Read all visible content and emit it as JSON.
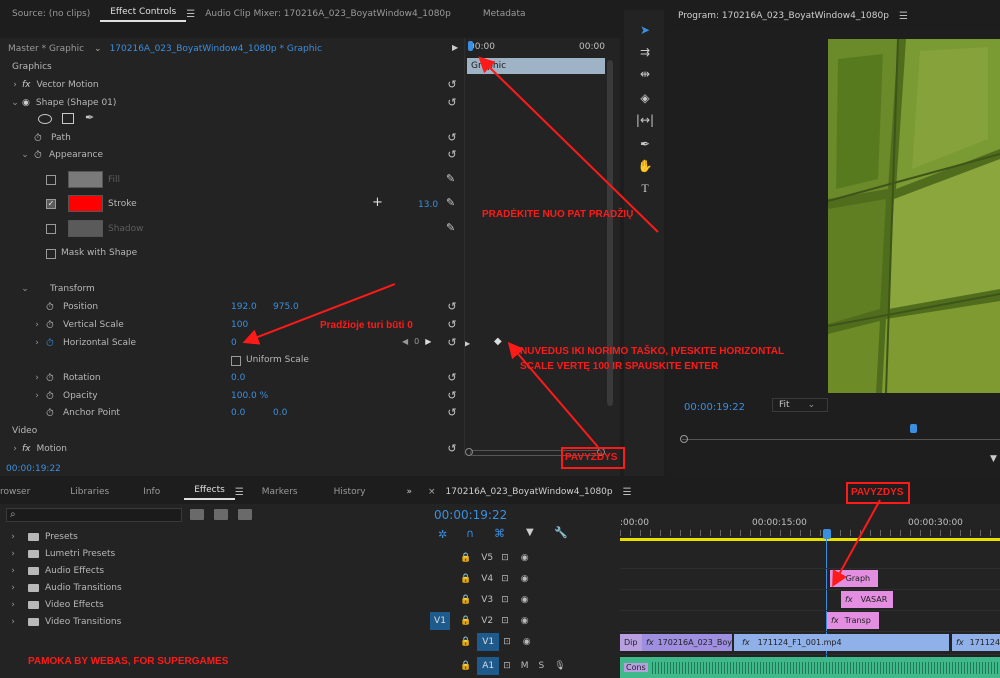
{
  "effect_controls_tabs": [
    "Source: (no clips)",
    "Effect Controls",
    "Audio Clip Mixer: 170216A_023_BoyatWindow4_1080p",
    "Metadata"
  ],
  "master_label": "Master * Graphic",
  "clip_label": "170216A_023_BoyatWindow4_1080p * Graphic",
  "graphics_section": "Graphics",
  "vector_motion": "Vector Motion",
  "shape_label": "Shape (Shape 01)",
  "path_label": "Path",
  "appearance_label": "Appearance",
  "fill_label": "Fill",
  "stroke_label": "Stroke",
  "stroke_width": "13.0",
  "shadow_label": "Shadow",
  "mask_label": "Mask with Shape",
  "transform_label": "Transform",
  "position_label": "Position",
  "position_x": "192.0",
  "position_y": "975.0",
  "vscale_label": "Vertical Scale",
  "vscale_value": "100",
  "hscale_label": "Horizontal Scale",
  "hscale_value": "0",
  "kf_value": "0",
  "uniform_label": "Uniform Scale",
  "rotation_label": "Rotation",
  "rotation_value": "0.0",
  "opacity_label": "Opacity",
  "opacity_value": "100.0 %",
  "anchor_label": "Anchor Point",
  "anchor_x": "0.0",
  "anchor_y": "0.0",
  "video_section": "Video",
  "motion_label": "Motion",
  "ec_timecode": "00:00:19:22",
  "mini_time_start": "00:00",
  "mini_time_end": "00:00",
  "graphic_bar": "Graphic",
  "program_title": "Program: 170216A_023_BoyatWindow4_1080p",
  "program_timecode": "00:00:19:22",
  "fit_label": "Fit",
  "annotations": {
    "restart": "PRADĖKITE NUO PAT PRADŽIŲ",
    "must_be_zero": "Pradžioje turi būti 0",
    "instruction_line1": "NUVEDUS IKI NORIMO TAŠKO, ĮVESKITE HORIZONTAL",
    "instruction_line2": "SCALE VERTĘ 100 IR SPAUSKITE ENTER",
    "example_top": "PAVYZDYS",
    "example_bottom": "PAVYZDYS",
    "credit": "PAMOKA BY WEBAS, FOR SUPERGAMES"
  },
  "effects_tabs": [
    "rowser",
    "Libraries",
    "Info",
    "Effects",
    "Markers",
    "History"
  ],
  "effects_tree": [
    "Presets",
    "Lumetri Presets",
    "Audio Effects",
    "Audio Transitions",
    "Video Effects",
    "Video Transitions"
  ],
  "sequence_title": "170216A_023_BoyatWindow4_1080p",
  "seq_timecode": "00:00:19:22",
  "ruler_labels": [
    ":00:00",
    "00:00:15:00",
    "00:00:30:00"
  ],
  "tracks": [
    "V5",
    "V4",
    "V3",
    "V2",
    "V1",
    "A1"
  ],
  "source_patch": "V1",
  "clips": {
    "v4": "Graph",
    "v3": "VASAR",
    "v2": "Transp",
    "v1a": "Dip",
    "v1b": "170216A_023_Boya",
    "v1c": "171124_F1_001.mp4",
    "v1d": "171124",
    "a1": "Cons"
  },
  "colors": {
    "accent_blue": "#3b8fe0",
    "annotation_red": "#ff1a1a",
    "clip_pink": "#e38ee0",
    "clip_purple": "#9e8fe0",
    "clip_blue": "#8fb0e8",
    "audio_green": "#3fb88a",
    "timeline_yellow": "#e8e000",
    "stroke_red": "#ff0000"
  }
}
